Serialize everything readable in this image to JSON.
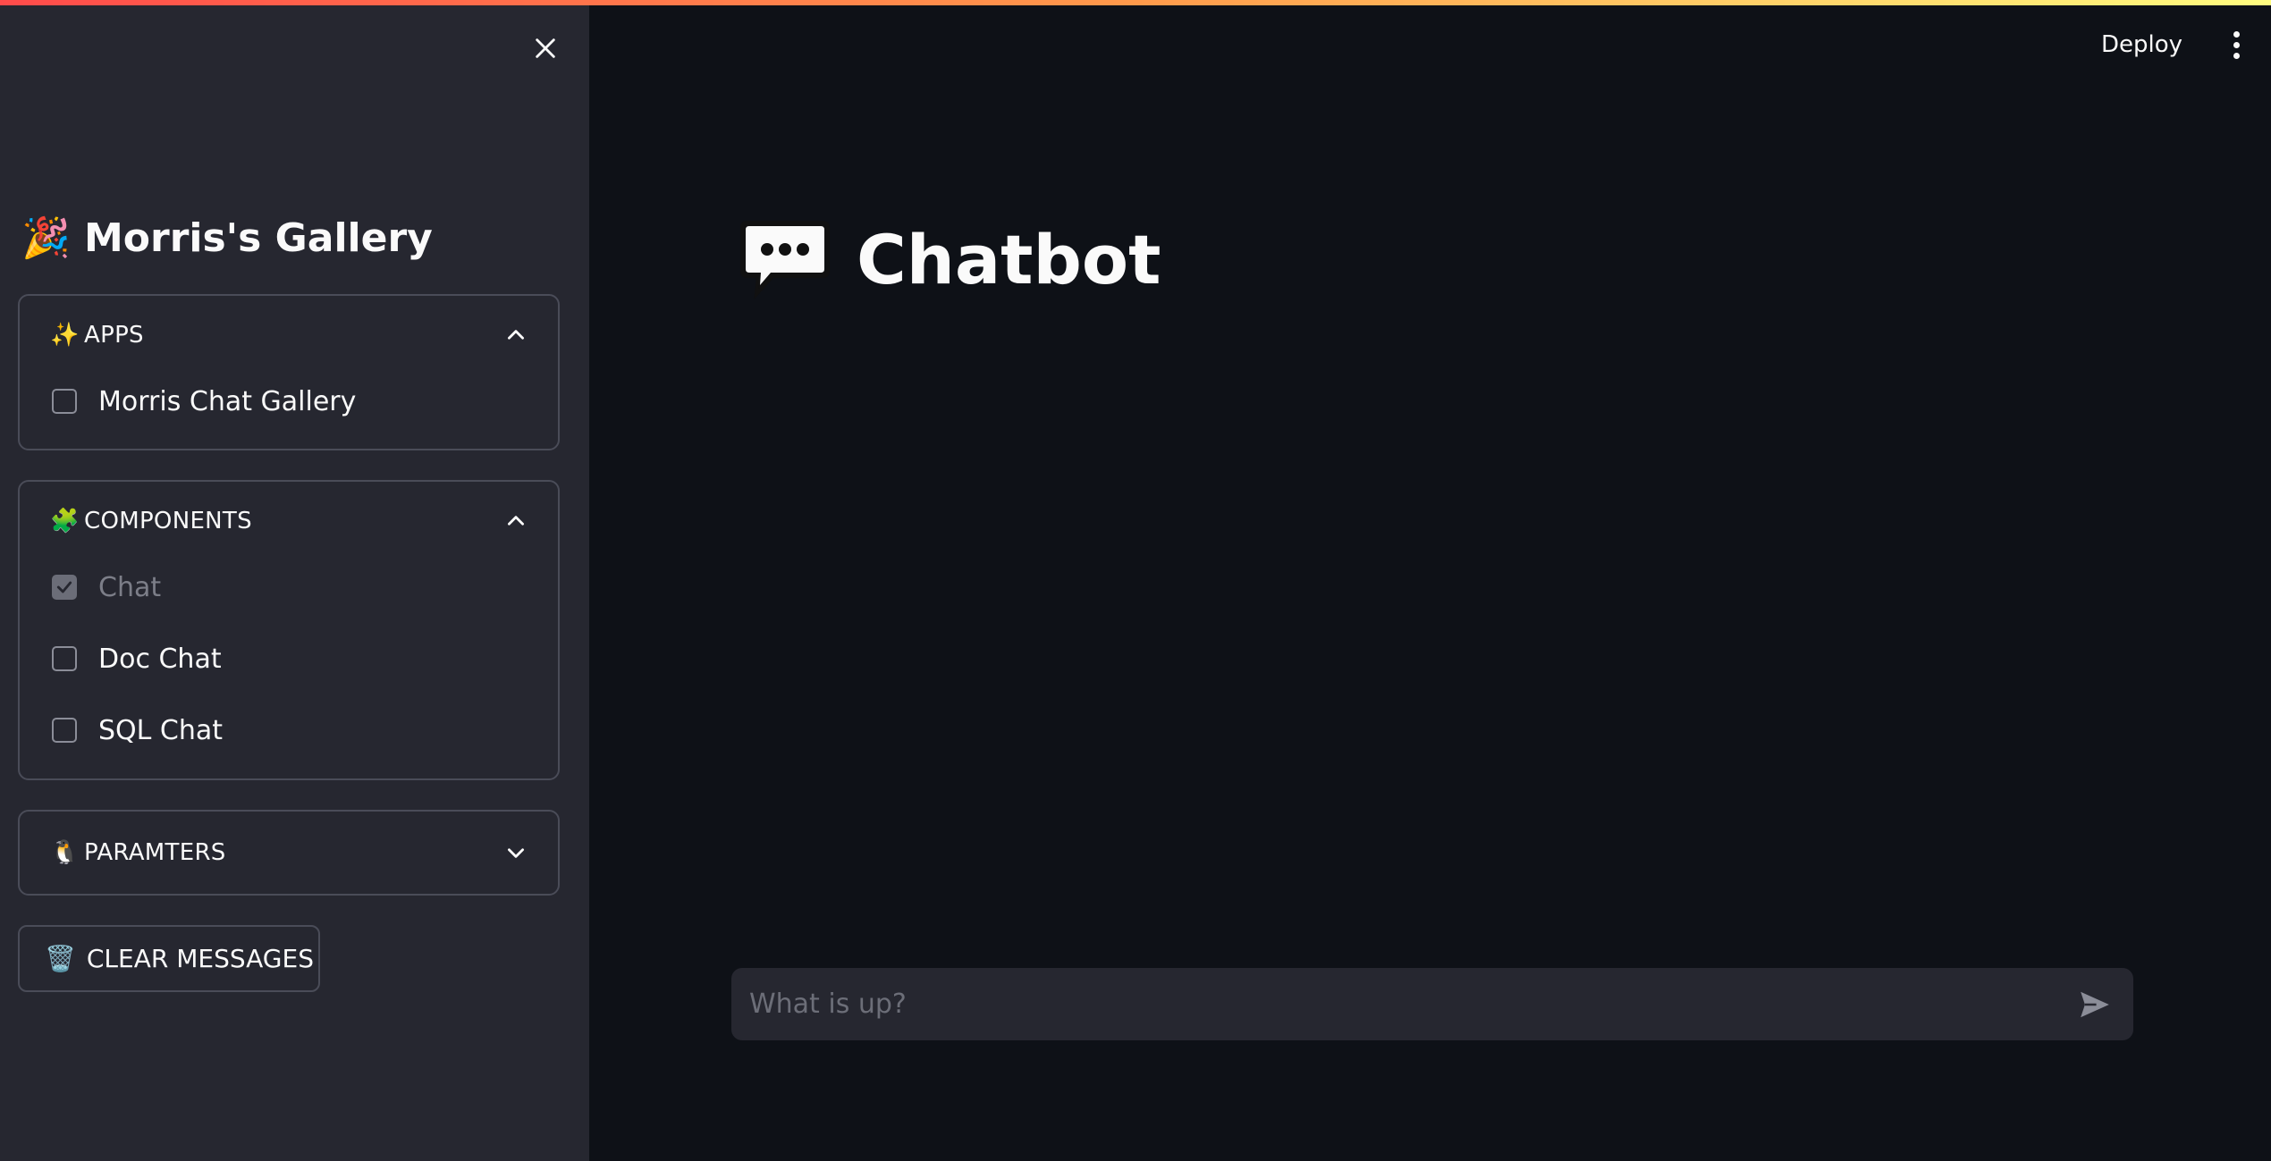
{
  "sidebar": {
    "title": "Morris's Gallery",
    "title_emoji": "🎉",
    "close_icon": "close-icon",
    "sections": [
      {
        "label": "APPS",
        "emoji": "✨",
        "expanded": true,
        "items": [
          {
            "label": "Morris Chat Gallery",
            "checked": false,
            "disabled": false
          }
        ]
      },
      {
        "label": "COMPONENTS",
        "emoji": "🧩",
        "expanded": true,
        "items": [
          {
            "label": "Chat",
            "checked": true,
            "disabled": true
          },
          {
            "label": "Doc Chat",
            "checked": false,
            "disabled": false
          },
          {
            "label": "SQL Chat",
            "checked": false,
            "disabled": false
          }
        ]
      },
      {
        "label": "PARAMTERS",
        "emoji": "🐧",
        "expanded": false,
        "items": []
      }
    ],
    "clear_button": {
      "label": "CLEAR MESSAGES",
      "emoji": "🗑️"
    }
  },
  "header": {
    "deploy_label": "Deploy",
    "menu_icon": "kebab-menu-icon"
  },
  "main": {
    "title": "Chatbot",
    "title_icon": "speech-bubble-icon"
  },
  "chat_input": {
    "placeholder": "What is up?",
    "value": "",
    "send_icon": "send-icon"
  },
  "colors": {
    "background": "#0e1117",
    "sidebar": "#262730",
    "text": "#fafafa",
    "accent_gradient": [
      "#ff4b4b",
      "#fffd80"
    ]
  }
}
